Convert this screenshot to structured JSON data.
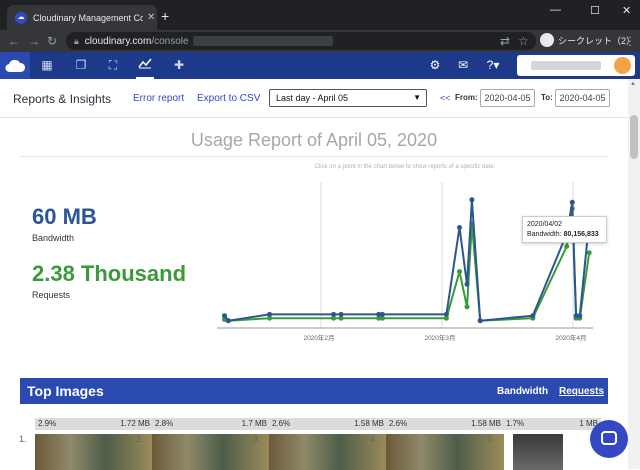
{
  "browser": {
    "tab_title": "Cloudinary Management Consol",
    "tab_close": "✕",
    "new_tab": "+",
    "url_domain": "cloudinary.com",
    "url_path": "/console",
    "incognito_label": "シークレット（2）",
    "controls": {
      "minimize": "—",
      "maximize": "☐",
      "close": "✕"
    }
  },
  "appnav": {
    "icons": [
      "dashboard-icon",
      "media-library-icon",
      "transformations-icon",
      "reports-icon",
      "addons-icon"
    ],
    "right_icons": [
      "settings-icon",
      "notifications-icon",
      "help-icon"
    ]
  },
  "toolbar": {
    "title": "Reports & Insights",
    "error_report": "Error report",
    "export_csv": "Export to CSV",
    "range_selected": "Last day - April 05",
    "prev": "<<",
    "from_label": "From:",
    "from_value": "2020-04-05",
    "to_label": "To:",
    "to_value": "2020-04-05"
  },
  "report": {
    "title": "Usage Report of April 05, 2020",
    "hint": "Click on a point in the chart below to show reports of a specific date.",
    "bandwidth_value": "60 MB",
    "bandwidth_label": "Bandwidth",
    "requests_value": "2.38 Thousand",
    "requests_label": "Requests",
    "colors": {
      "bandwidth": "#2d5592",
      "requests": "#3a9a3a"
    }
  },
  "chart_data": {
    "type": "line",
    "x_tick_labels": [
      "2020年2月",
      "2020年3月",
      "2020年4月"
    ],
    "series": [
      {
        "values": [
          0.05,
          0.01,
          0.06,
          0.06,
          0.06,
          0.06,
          0.06,
          0.06,
          0.75,
          0.3,
          0.97,
          0.01,
          0.05,
          0.7,
          0.95,
          0.05,
          0.05,
          0.8
        ]
      },
      {
        "values": [
          0.02,
          0.01,
          0.03,
          0.03,
          0.03,
          0.03,
          0.03,
          0.03,
          0.4,
          0.12,
          0.78,
          0.01,
          0.03,
          0.6,
          0.9,
          0.03,
          0.03,
          0.55
        ]
      }
    ],
    "tooltip": {
      "date": "2020/04/02",
      "label": "Bandwidth:",
      "value": "80,156,833"
    }
  },
  "top_images": {
    "title": "Top Images",
    "tab_bandwidth": "Bandwidth",
    "tab_requests": "Requests",
    "items": [
      {
        "rank": "1.",
        "pct": "2.9%",
        "size": "1.72 MB"
      },
      {
        "rank": "2.",
        "pct": "2.8%",
        "size": "1.7 MB"
      },
      {
        "rank": "3.",
        "pct": "2.6%",
        "size": "1.58 MB"
      },
      {
        "rank": "4.",
        "pct": "2.6%",
        "size": "1.58 MB"
      },
      {
        "rank": "5.",
        "pct": "1.7%",
        "size": "1 MB"
      }
    ]
  }
}
